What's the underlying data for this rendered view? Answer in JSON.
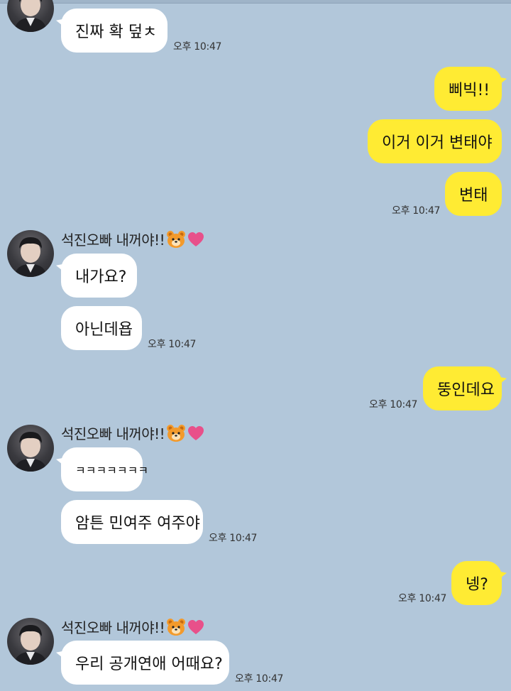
{
  "chat": {
    "sender_name": "석진오빠 내꺼야!!",
    "sender_emojis": [
      "bear-face-icon",
      "heart-icon"
    ],
    "colors": {
      "background": "#b2c7da",
      "incoming_bubble": "#ffffff",
      "outgoing_bubble": "#ffeb33"
    },
    "messages": [
      {
        "dir": "in",
        "text": "진짜 확 덮ㅊ"
      },
      {
        "dir": "out",
        "text": "삐빅!!"
      },
      {
        "dir": "out",
        "text": "이거 이거 변태야"
      },
      {
        "dir": "out",
        "text": "변태"
      },
      {
        "dir": "in",
        "text": "내가요?"
      },
      {
        "dir": "in",
        "text": "아닌데욥"
      },
      {
        "dir": "out",
        "text": "뚱인데요"
      },
      {
        "dir": "in",
        "text": "ㅋㅋㅋㅋㅋㅋㅋ"
      },
      {
        "dir": "in",
        "text": "암튼 민여주 여주야"
      },
      {
        "dir": "out",
        "text": "넹?"
      },
      {
        "dir": "in",
        "text": "우리 공개연애 어때요?"
      }
    ],
    "timestamps": [
      "오후 10:47",
      "오후 10:47",
      "오후 10:47",
      "오후 10:47",
      "오후 10:47",
      "오후 10:47",
      "오후 10:47"
    ]
  }
}
